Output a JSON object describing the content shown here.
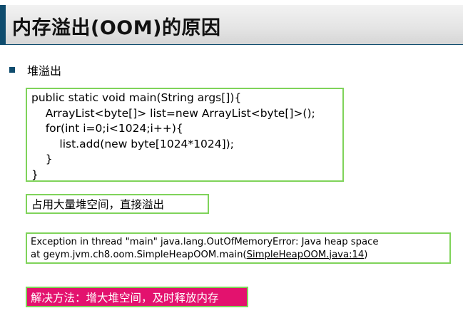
{
  "slide": {
    "title": "内存溢出(OOM)的原因",
    "bullet": "堆溢出",
    "code_lines": [
      "public static void main(String args[]){",
      "    ArrayList<byte[]> list=new ArrayList<byte[]>();",
      "    for(int i=0;i<1024;i++){",
      "        list.add(new byte[1024*1024]);",
      "    }",
      "}"
    ],
    "note": "占用大量堆空间，直接溢出",
    "exception": {
      "line1": "Exception in thread \"main\" java.lang.OutOfMemoryError: Java heap space",
      "line2_prefix": "at geym.jvm.ch8.oom.SimpleHeapOOM.main(",
      "line2_link": "SimpleHeapOOM.java:14",
      "line2_suffix": ")"
    },
    "solution": "解决方法：增大堆空间，及时释放内存",
    "colors": {
      "accent": "#0f4c6e",
      "box_border": "#7fd35a",
      "solution_bg": "#e3126e"
    }
  }
}
